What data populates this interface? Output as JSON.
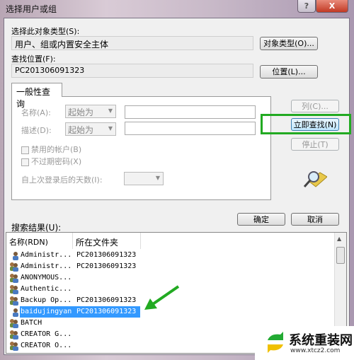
{
  "window": {
    "title": "选择用户或组",
    "help": "?",
    "close": "X"
  },
  "object_type": {
    "label": "选择此对象类型(S):",
    "value": "用户、组或内置安全主体",
    "button": "对象类型(O)..."
  },
  "location": {
    "label": "查找位置(F):",
    "value": "PC201306091323",
    "button": "位置(L)..."
  },
  "query": {
    "tab": "一般性查询",
    "name_label": "名称(A):",
    "name_mode": "起始为",
    "name_value": "",
    "desc_label": "描述(D):",
    "desc_mode": "起始为",
    "desc_value": "",
    "disabled_accounts": "禁用的帐户(B)",
    "disabled_checked": false,
    "non_expiring": "不过期密码(X)",
    "non_expiring_checked": false,
    "days_label": "自上次登录后的天数(I):",
    "days_value": ""
  },
  "side_buttons": {
    "columns": "列(C)...",
    "find_now": "立即查找(N)",
    "stop": "停止(T)"
  },
  "ok": "确定",
  "cancel": "取消",
  "results": {
    "label": "搜索结果(U):",
    "columns": [
      "名称(RDN)",
      "所在文件夹"
    ],
    "rows": [
      {
        "name": "Administr...",
        "folder": "PC201306091323",
        "icon": "user-icon"
      },
      {
        "name": "Administr...",
        "folder": "PC201306091323",
        "icon": "group-icon"
      },
      {
        "name": "ANONYMOUS...",
        "folder": "",
        "icon": "group-icon"
      },
      {
        "name": "Authentic...",
        "folder": "",
        "icon": "group-icon"
      },
      {
        "name": "Backup Op...",
        "folder": "PC201306091323",
        "icon": "group-icon"
      },
      {
        "name": "baidujingyan",
        "folder": "PC201306091323",
        "icon": "user-icon",
        "selected": true
      },
      {
        "name": "BATCH",
        "folder": "",
        "icon": "group-icon"
      },
      {
        "name": "CREATOR G...",
        "folder": "",
        "icon": "group-icon"
      },
      {
        "name": "CREATOR O...",
        "folder": "",
        "icon": "group-icon"
      }
    ]
  },
  "annotation_color": "#22aa22",
  "watermark": {
    "text": "系统重装网",
    "url": "www.xtcz2.com"
  }
}
